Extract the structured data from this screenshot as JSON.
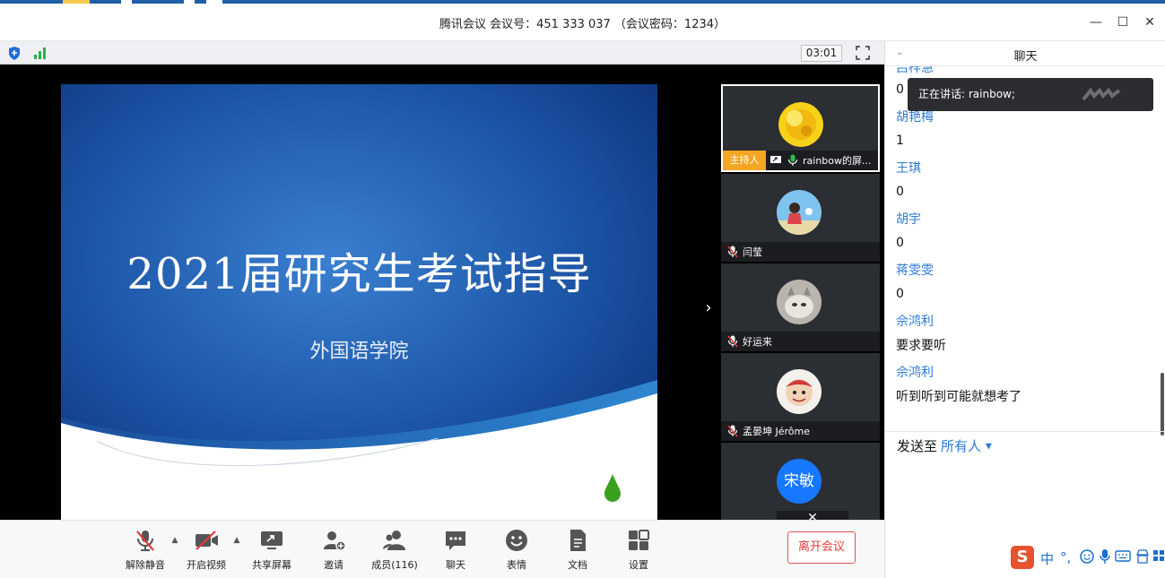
{
  "window": {
    "title": "腾讯会议 会议号：451 333 037 （会议密码：1234）",
    "minimize": "—",
    "maximize": "☐",
    "close": "✕"
  },
  "status": {
    "timer": "03:01"
  },
  "slide": {
    "title": "2021届研究生考试指导",
    "subtitle": "外国语学院"
  },
  "participants": [
    {
      "name": "rainbow的屏...",
      "host_badge": "主持人",
      "active": true,
      "avatar": "sunflower-avatar"
    },
    {
      "name": "闫莹",
      "avatar": "girl-illustration-avatar"
    },
    {
      "name": "好运来",
      "avatar": "cat-photo-avatar"
    },
    {
      "name": "孟晏坤 Jérôme",
      "avatar": "cartoon-avatar"
    },
    {
      "name": "宋敏",
      "avatar_text": "宋敏",
      "avatar_color": "#1677ff"
    }
  ],
  "participant_overlay_close": "✕",
  "toolbar": {
    "buttons": [
      {
        "label": "解除静音",
        "icon": "mic-muted-icon"
      },
      {
        "label": "开启视频",
        "icon": "video-off-icon"
      },
      {
        "label": "共享屏幕",
        "icon": "share-screen-icon"
      },
      {
        "label": "邀请",
        "icon": "invite-icon"
      },
      {
        "label": "成员(116)",
        "icon": "members-icon"
      },
      {
        "label": "聊天",
        "icon": "chat-icon"
      },
      {
        "label": "表情",
        "icon": "emoji-icon"
      },
      {
        "label": "文档",
        "icon": "document-icon"
      },
      {
        "label": "设置",
        "icon": "settings-icon"
      }
    ],
    "leave_label": "离开会议"
  },
  "chat": {
    "header": "聊天",
    "messages": [
      {
        "type": "sender",
        "text": "吕梓慧"
      },
      {
        "type": "text",
        "text": "0"
      },
      {
        "type": "sender",
        "text": "胡艳梅"
      },
      {
        "type": "text",
        "text": "1"
      },
      {
        "type": "sender",
        "text": "王琪"
      },
      {
        "type": "text",
        "text": "0"
      },
      {
        "type": "sender",
        "text": "胡宇"
      },
      {
        "type": "text",
        "text": "0"
      },
      {
        "type": "sender",
        "text": "蒋雯雯"
      },
      {
        "type": "text",
        "text": "0"
      },
      {
        "type": "sender",
        "text": "佘鸿利"
      },
      {
        "type": "text",
        "text": "要求要听"
      },
      {
        "type": "sender",
        "text": "佘鸿利"
      },
      {
        "type": "text",
        "text": "听到听到可能就想考了"
      }
    ],
    "send_to_label": "发送至",
    "send_to_value": "所有人",
    "speaking_tooltip": "正在讲话: rainbow;"
  },
  "ime": {
    "logo": "S",
    "mode": "中"
  },
  "colors": {
    "accent_blue": "#2a7ad7",
    "host_orange": "#f5a623",
    "leave_red": "#e33b3b",
    "stage_bg": "#000000",
    "slide_blue": "#1d5aa8"
  }
}
